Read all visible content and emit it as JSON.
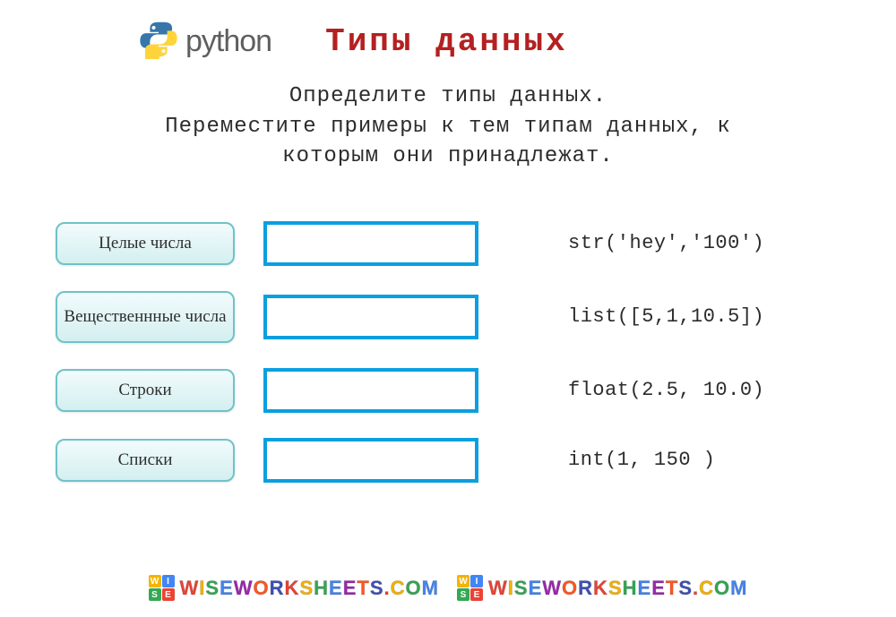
{
  "header": {
    "brand": "python",
    "title": "Типы данных"
  },
  "instructions": {
    "line1": "Определите типы данных.",
    "line2": "Переместите примеры к тем типам данных, к",
    "line3": "которым они принадлежат."
  },
  "rows": [
    {
      "label": "Целые числа",
      "example": "str('hey','100')"
    },
    {
      "label": "Вещественнные числа",
      "example": "list([5,1,10.5])"
    },
    {
      "label": "Строки",
      "example": "float(2.5, 10.0)"
    },
    {
      "label": "Списки",
      "example": "int(1, 150 )"
    }
  ],
  "watermark": {
    "grid": [
      "W",
      "I",
      "S",
      "E"
    ],
    "text": "WISEWORKSHEETS.COM",
    "colors": [
      "#ea4335",
      "#f4b400",
      "#34a853",
      "#4285f4",
      "#9c27b0",
      "#ff5722",
      "#3f51b5"
    ]
  }
}
